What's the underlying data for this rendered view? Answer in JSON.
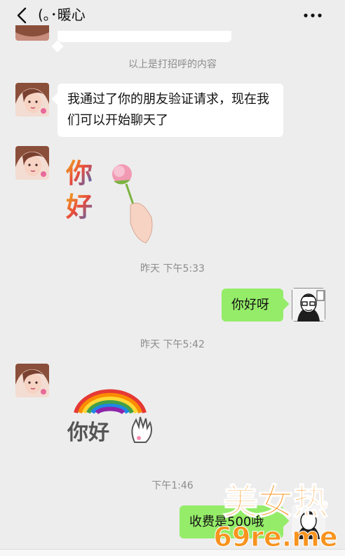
{
  "header": {
    "title": "(｡･暖心"
  },
  "messages": {
    "system_1": "以上是打招呼的内容",
    "text_1": "我通过了你的朋友验证请求，现在我们可以开始聊天了",
    "time_1": "昨天 下午5:33",
    "text_2": "你好呀",
    "time_2": "昨天 下午5:42",
    "time_3": "下午1:46",
    "text_3": "收费是500哦"
  },
  "stickers": {
    "sticker_1_text": "你好",
    "sticker_2_text": "你好"
  },
  "watermark": {
    "line1": "美女热",
    "line2": "69re.me"
  },
  "colors": {
    "background": "#ededed",
    "bubble_left": "#ffffff",
    "bubble_right": "#95ec69",
    "system_text": "#8c8c8c"
  }
}
